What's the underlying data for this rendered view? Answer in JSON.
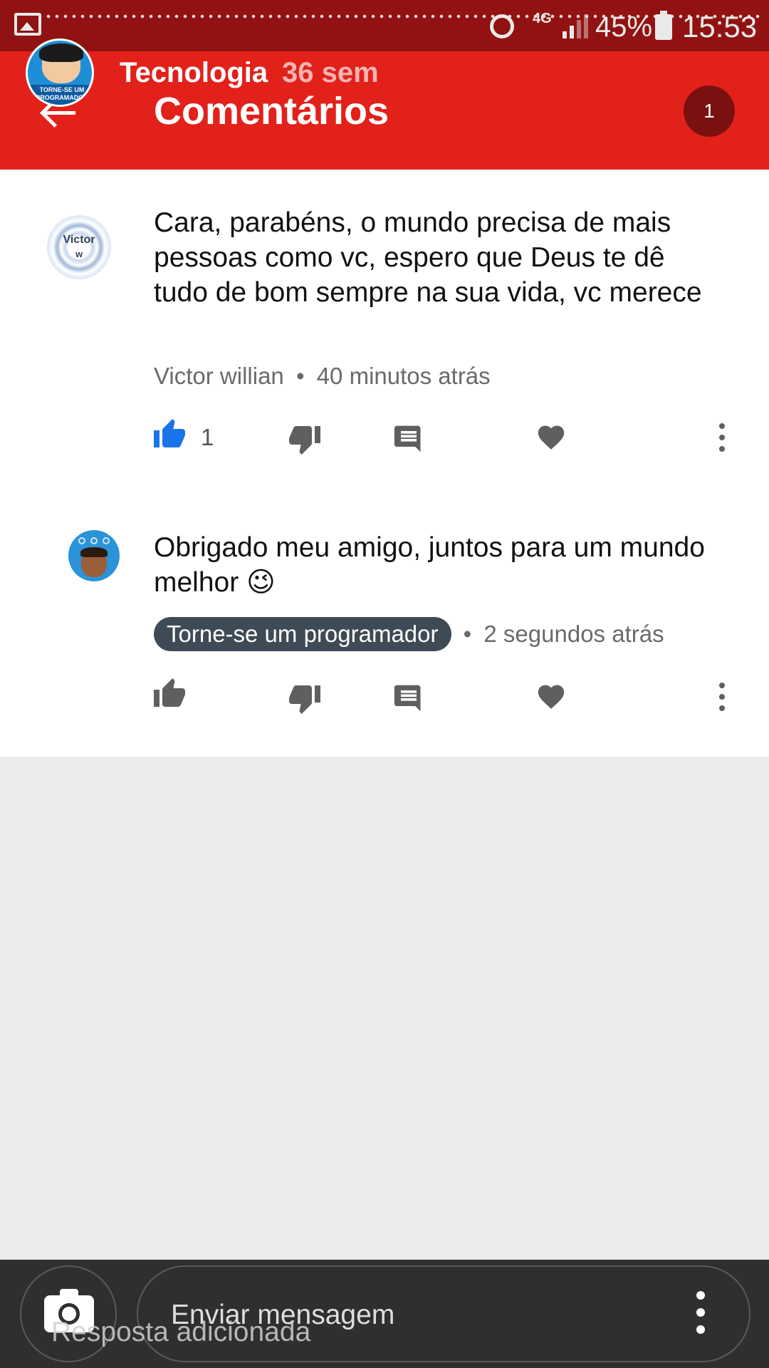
{
  "status_bar": {
    "network": "4G",
    "battery": "45%",
    "time": "15:53"
  },
  "header": {
    "channel_logo_text": "TORNE-SE UM PROGRAMADOR",
    "channel_name": "Tecnologia",
    "channel_age": "36 sem",
    "title": "Comentários",
    "comment_count": "1"
  },
  "comments": [
    {
      "avatar_text_1": "Victor",
      "avatar_text_2": "w",
      "text": "Cara, parabéns, o mundo precisa de mais pessoas como vc, espero que Deus te dê tudo de bom sempre na sua vida, vc merece",
      "author": "Victor willian",
      "separator": "•",
      "time": "40 minutos atrás",
      "like_count": "1",
      "liked": true
    },
    {
      "text": "Obrigado meu amigo, juntos para um mundo melhor 😉",
      "author": "Torne-se um programador",
      "separator": "•",
      "time": "2 segundos atrás",
      "like_count": "",
      "liked": false
    }
  ],
  "bottom_bar": {
    "input_placeholder": "Enviar mensagem",
    "toast": "Resposta adicionada"
  },
  "colors": {
    "status_bar": "#911212",
    "header": "#e2211b",
    "badge": "#7a1010",
    "like_active": "#1a73e8",
    "icon_gray": "#5f5f5f",
    "author_chip": "#3e4b56"
  },
  "icons": {
    "like": "thumb-up-icon",
    "dislike": "thumb-down-icon",
    "reply": "comment-icon",
    "heart": "heart-icon",
    "more": "more-vertical-icon",
    "camera": "camera-icon",
    "back": "back-arrow-icon"
  }
}
